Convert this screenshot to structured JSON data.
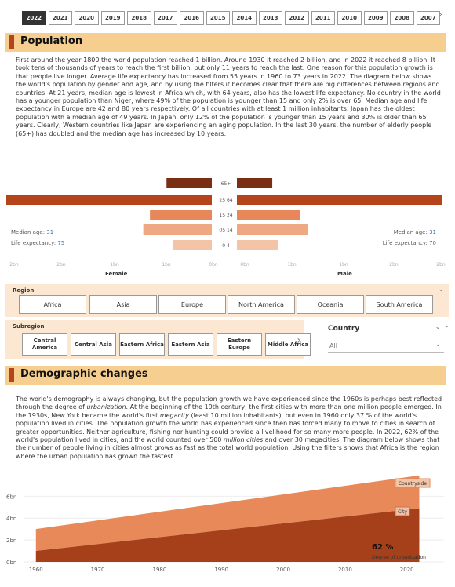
{
  "years": [
    "2022",
    "2021",
    "2020",
    "2019",
    "2018",
    "2017",
    "2016",
    "2015",
    "2014",
    "2013",
    "2012",
    "2011",
    "2010",
    "2009",
    "2008",
    "2007"
  ],
  "population": {
    "title": "Population",
    "text": "First around the year 1800 the world population reached 1 billion. Around 1930 it reached 2 billion, and in 2022 it reached 8 billion. It took tens of thousands of years to reach the first billion, but only 11 years to reach the last. One reason for this population growth is that people live longer. Average life expectancy has increased from 55 years in 1960 to 73 years in 2022. The diagram below shows the world's population by gender and age, and by using the filters it becomes clear that there are big differences between regions and countries. At 21 years, median age is lowest in Africa which, with 64 years, also has the lowest life expectancy. No country in the world has a younger population than Niger, where 49% of the population is younger than 15 and only 2% is over 65. Median age and life expectancy in Europe are 42 and 80 years respectively. Of all countries with at least 1 million inhabitants, Japan has the oldest population with a median age of 49 years. In Japan, only 12% of the population is younger than 15 years and 30% is older than 65 years. Clearly, Western countries like Japan are experiencing an aging population. In the last 30 years, the number of elderly people (65+) has doubled and the median age has increased by 10 years."
  },
  "pyramid": {
    "female_label": "Female",
    "male_label": "Male",
    "age_groups": [
      "65+",
      "25 64",
      "15 24",
      "05 14",
      "0 4"
    ],
    "female_values_bn": [
      0.41,
      1.86,
      0.56,
      0.62,
      0.35
    ],
    "male_values_bn": [
      0.32,
      1.86,
      0.57,
      0.64,
      0.37
    ],
    "axis_left": [
      "2bn",
      "2bn",
      "1bn",
      "1bn",
      "0bn"
    ],
    "axis_right": [
      "0bn",
      "1bn",
      "1bn",
      "2bn",
      "2bn"
    ],
    "female_stats": {
      "median_label": "Median age:",
      "median_value": "31",
      "life_label": "Life expectancy:",
      "life_value": "75"
    },
    "male_stats": {
      "median_label": "Median age:",
      "median_value": "31",
      "life_label": "Life expectancy:",
      "life_value": "70"
    },
    "colors": [
      "#7a2f14",
      "#b5441b",
      "#e8885a",
      "#eea982",
      "#f4c4a6"
    ]
  },
  "filters": {
    "region_label": "Region",
    "regions": [
      "Africa",
      "Asia",
      "Europe",
      "North America",
      "Oceania",
      "South America"
    ],
    "subregion_label": "Subregion",
    "subregions": [
      "Central America",
      "Central Asia",
      "Eastern Africa",
      "Eastern Asia",
      "Eastern Europe",
      "Middle Africa"
    ],
    "country_label": "Country",
    "country_value": "All"
  },
  "demographic": {
    "title": "Demographic changes",
    "text_a": "The world's demography is always changing, but the population growth we have experienced since the 1960s is perhaps best reflected through the degree of ",
    "text_a_em": "urbanization",
    "text_b": ". At the beginning of the 19th century, the first cities with more than one million people emerged. In the 1930s, New York became the world's first ",
    "text_b_em": "megacity",
    "text_c": " (least 10 million inhabitants), but even in 1960 only 37 % of the world's population lived in cities. The population growth the world has experienced since then has forced many to move to cities in search of greater opportunities. Neither agriculture, fishing nor hunting could provide a livelihood for so many more people. In 2022, 62% of the world's population lived in cities, and the world counted over 500 ",
    "text_c_em": "million cities",
    "text_d": " and over 30 megacities. The diagram below shows that the number of people living in cities almost grows as fast as the total world population. Using the filters shows that Africa is the region where the urban population has grown the fastest."
  },
  "chart_data": {
    "type": "area",
    "x": [
      1960,
      2022
    ],
    "series": [
      {
        "name": "Countryside",
        "values": [
          2.0,
          3.0
        ]
      },
      {
        "name": "City",
        "values": [
          1.0,
          4.9
        ]
      }
    ],
    "yticks": [
      "0bn",
      "2bn",
      "4bn",
      "6bn"
    ],
    "xticks": [
      "1960",
      "1970",
      "1980",
      "1990",
      "2000",
      "2010",
      "2020"
    ],
    "xlim": [
      1958,
      2026
    ],
    "ylim": [
      0,
      7.6
    ],
    "colors": [
      "#e8895a",
      "#a5401b"
    ],
    "legend": [
      "Countryside",
      "City"
    ],
    "kpi_value": "62 %",
    "kpi_label": "Degree of urbanization"
  }
}
